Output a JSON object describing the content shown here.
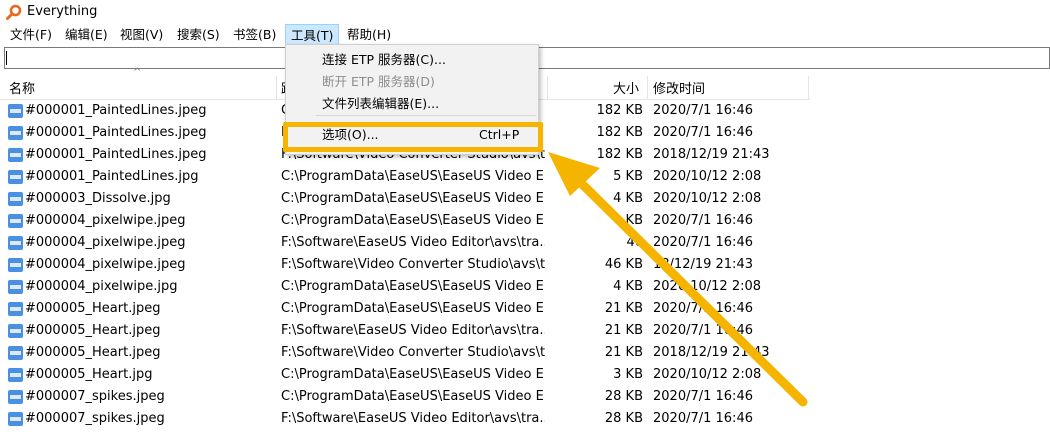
{
  "window": {
    "title": "Everything"
  },
  "menubar": {
    "items": [
      "文件(F)",
      "编辑(E)",
      "视图(V)",
      "搜索(S)",
      "书签(B)",
      "工具(T)",
      "帮助(H)"
    ]
  },
  "search": {
    "value": ""
  },
  "columns": {
    "name": "名称",
    "path": "路",
    "size": "大小",
    "date": "修改时间"
  },
  "tools_menu": {
    "items": [
      {
        "label": "连接 ETP 服务器(C)...",
        "shortcut": "",
        "disabled": false
      },
      {
        "label": "断开 ETP 服务器(D)",
        "shortcut": "",
        "disabled": true
      },
      {
        "label": "文件列表编辑器(E)...",
        "shortcut": "",
        "disabled": false
      },
      {
        "label": "选项(O)...",
        "shortcut": "Ctrl+P",
        "disabled": false
      }
    ]
  },
  "rows": [
    {
      "name": "#000001_PaintedLines.jpeg",
      "path": "C",
      "size": "182 KB",
      "date": "2020/7/1 16:46"
    },
    {
      "name": "#000001_PaintedLines.jpeg",
      "path": "F",
      "size": "182 KB",
      "date": "2020/7/1 16:46"
    },
    {
      "name": "#000001_PaintedLines.jpeg",
      "path": "F:\\Software\\Video Converter Studio\\avs\\t...",
      "size": "182 KB",
      "date": "2018/12/19 21:43"
    },
    {
      "name": "#000001_PaintedLines.jpg",
      "path": "C:\\ProgramData\\EaseUS\\EaseUS Video E...",
      "size": "5 KB",
      "date": "2020/10/12 2:08"
    },
    {
      "name": "#000003_Dissolve.jpg",
      "path": "C:\\ProgramData\\EaseUS\\EaseUS Video E...",
      "size": "4 KB",
      "date": "2020/10/12 2:08"
    },
    {
      "name": "#000004_pixelwipe.jpeg",
      "path": "C:\\ProgramData\\EaseUS\\EaseUS Video E...",
      "size": "KB",
      "date": "2020/7/1 16:46"
    },
    {
      "name": "#000004_pixelwipe.jpeg",
      "path": "F:\\Software\\EaseUS Video Editor\\avs\\tra...",
      "size": "46",
      "date": "2020/7/1 16:46"
    },
    {
      "name": "#000004_pixelwipe.jpeg",
      "path": "F:\\Software\\Video Converter Studio\\avs\\t...",
      "size": "46 KB",
      "date": "18/12/19 21:43"
    },
    {
      "name": "#000004_pixelwipe.jpg",
      "path": "C:\\ProgramData\\EaseUS\\EaseUS Video E...",
      "size": "4 KB",
      "date": "2020 10/12 2:08"
    },
    {
      "name": "#000005_Heart.jpeg",
      "path": "C:\\ProgramData\\EaseUS\\EaseUS Video E...",
      "size": "21 KB",
      "date": "2020/7/1 16:46"
    },
    {
      "name": "#000005_Heart.jpeg",
      "path": "F:\\Software\\EaseUS Video Editor\\avs\\tra...",
      "size": "21 KB",
      "date": "2020/7/1 16:46"
    },
    {
      "name": "#000005_Heart.jpeg",
      "path": "F:\\Software\\Video Converter Studio\\avs\\t...",
      "size": "21 KB",
      "date": "2018/12/19 21:43"
    },
    {
      "name": "#000005_Heart.jpg",
      "path": "C:\\ProgramData\\EaseUS\\EaseUS Video E...",
      "size": "3 KB",
      "date": "2020/10/12 2:08"
    },
    {
      "name": "#000007_spikes.jpeg",
      "path": "C:\\ProgramData\\EaseUS\\EaseUS Video E...",
      "size": "28 KB",
      "date": "2020/7/1 16:46"
    },
    {
      "name": "#000007_spikes.jpeg",
      "path": "F:\\Software\\EaseUS Video Editor\\avs\\tra...",
      "size": "28 KB",
      "date": "2020/7/1 16:46"
    }
  ],
  "colors": {
    "highlight": "#f5b400",
    "menu_active": "#cce8ff"
  }
}
